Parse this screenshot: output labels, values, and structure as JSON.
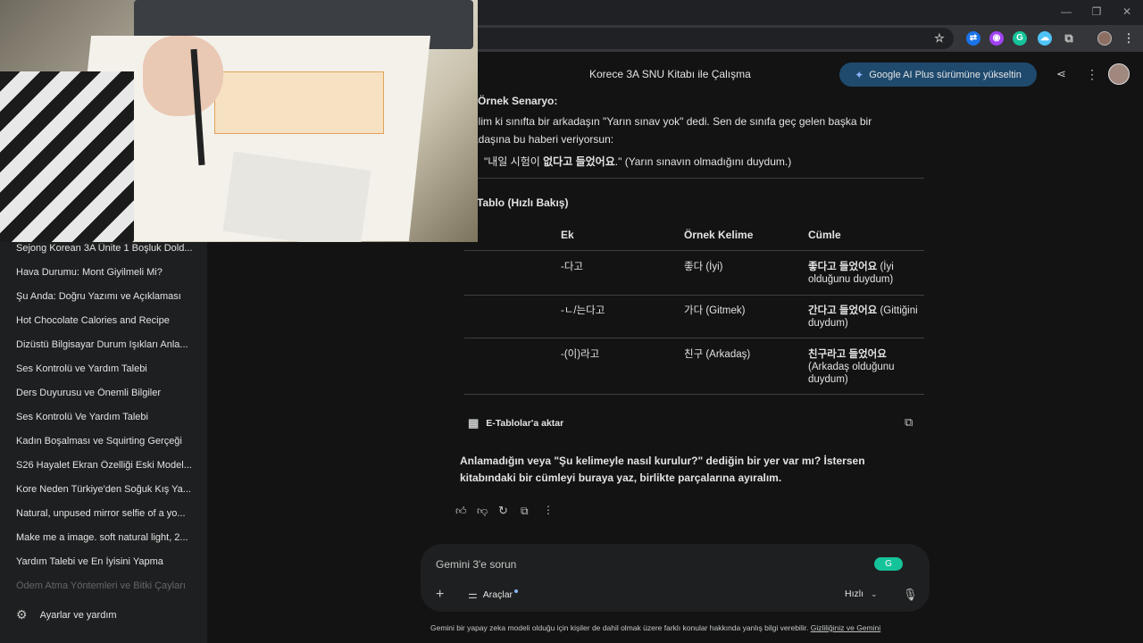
{
  "window": {
    "controls": [
      "—",
      "❐",
      "✕"
    ]
  },
  "extensions": {
    "icons": [
      "bookmark-star-icon",
      "ext-translate-icon",
      "ext-profile-icon",
      "grammarly-icon",
      "ext-cloud-icon",
      "puzzle-icon",
      "avatar",
      "kebab-menu-icon"
    ]
  },
  "header": {
    "title": "Korece 3A SNU Kitabı ile Çalışma",
    "upgrade_label": "Google AI Plus sürümüne yükseltin"
  },
  "sidebar": {
    "items": [
      "Sejong Korean 3A Ünite 1 Boşluk Dold...",
      "Hava Durumu: Mont Giyilmeli Mi?",
      "Şu Anda: Doğru Yazımı ve Açıklaması",
      "Hot Chocolate Calories and Recipe",
      "Dizüstü Bilgisayar Durum Işıkları Anla...",
      "Ses Kontrolü ve Yardım Talebi",
      "Ders Duyurusu ve Önemli Bilgiler",
      "Ses Kontrolü Ve Yardım Talebi",
      "Kadın Boşalması ve Squirting Gerçeği",
      "S26 Hayalet Ekran Özelliği Eski Model...",
      "Kore Neden Türkiye'den Soğuk Kış Ya...",
      "Natural, unpused mirror selfie of a yo...",
      "Make me a image. soft natural light, 2...",
      "Yardım Talebi ve En İyisini Yapma",
      "Ödem Atma Yöntemleri ve Bitki Çayları"
    ],
    "settings_label": "Ayarlar ve yardım"
  },
  "response": {
    "scenario_heading": "Örnek Senaryo:",
    "scenario_line1": "elim ki sınıfta bir arkadaşın \"Yarın sınav yok\" dedi. Sen de sınıfa geç gelen başka bir",
    "scenario_line2": "adaşına bu haberi veriyorsun:",
    "quote_prefix": "\"내일 시험이 ",
    "quote_bold": "없다고 들었어요",
    "quote_suffix": ".\" (Yarın sınavın olmadığını duydum.)",
    "table_heading": "et Tablo (Hızlı Bakış)",
    "table": {
      "headers": [
        "Ek",
        "Örnek Kelime",
        "Cümle"
      ],
      "rows": [
        {
          "ek": "-다고",
          "kelime": "좋다 (İyi)",
          "cumle_bold": "좋다고 들었어요",
          "cumle_rest": "(İyi olduğunu duydum)"
        },
        {
          "ek": "-ㄴ/는다고",
          "kelime": "가다 (Gitmek)",
          "cumle_bold": "간다고 들었어요",
          "cumle_rest": "(Gittiğini duydum)"
        },
        {
          "ek": "-(이)라고",
          "kelime": "친구 (Arkadaş)",
          "cumle_bold": "친구라고 들었어요",
          "cumle_rest": "(Arkadaş olduğunu duydum)"
        }
      ]
    },
    "export_label": "E-Tablolar'a aktar",
    "closing_line1": "Anlamadığın veya \"Şu kelimeyle nasıl kurulur?\" dediğin bir yer var mı? İstersen",
    "closing_line2": "kitabındaki bir cümleyi buraya yaz, birlikte parçalarına ayıralım."
  },
  "composer": {
    "placeholder": "Gemini 3'e sorun",
    "tools_label": "Araçlar",
    "mode_label": "Hızlı"
  },
  "footer": {
    "disclaimer": "Gemini bir yapay zeka modeli olduğu için kişiler de dahil olmak üzere farklı konular hakkında yanlış bilgi verebilir.",
    "privacy_link": "Gizliliğiniz ve Gemini"
  },
  "colors": {
    "background": "#131314",
    "sidebar": "#1e1f20",
    "upgrade_button": "#1f4a6e",
    "accent": "#8ab4f8"
  }
}
